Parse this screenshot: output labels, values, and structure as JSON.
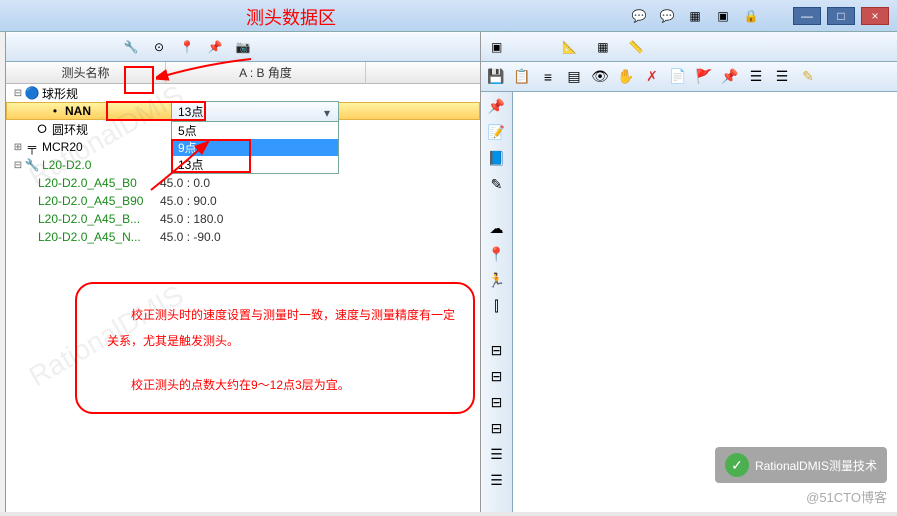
{
  "titlebar_icons": [
    "chat",
    "chat2",
    "grid",
    "layout",
    "lock"
  ],
  "window_controls": {
    "min": "—",
    "max": "□",
    "close": "×"
  },
  "annotation": {
    "title": "测头数据区",
    "note_line1": "校正测头时的速度设置与测量时一致，速度与测量精度有一定关系，尤其是触发测头。",
    "note_line2": "校正测头的点数大约在9～12点3层为宜。"
  },
  "toolbar1_icons": [
    "probe",
    "dot",
    "pin",
    "pin2",
    "camera"
  ],
  "table_headers": {
    "col1": "测头名称",
    "col2": "A : B 角度"
  },
  "tree": {
    "sphere_gauge": "球形规",
    "nan": "NAN",
    "ring_gauge": "圆环规",
    "mcr20": "MCR20",
    "l20": "L20-D2.0",
    "children": [
      {
        "name": "L20-D2.0_A45_B0",
        "angle": "45.0 : 0.0"
      },
      {
        "name": "L20-D2.0_A45_B90",
        "angle": "45.0 : 90.0"
      },
      {
        "name": "L20-D2.0_A45_B...",
        "angle": "45.0 : 180.0"
      },
      {
        "name": "L20-D2.0_A45_N...",
        "angle": "45.0 : -90.0"
      }
    ]
  },
  "dropdown": {
    "current": "13点",
    "options": [
      "5点",
      "9点",
      "13点"
    ]
  },
  "right_toolbar1": [
    "panel",
    "axis",
    "grid2",
    "ruler"
  ],
  "right_toolbar2": [
    "save",
    "props",
    "layer",
    "stack",
    "vis",
    "hand",
    "del",
    "copy",
    "flag",
    "mark",
    "list",
    "list2",
    "pen"
  ],
  "vtoolbar": [
    "pin",
    "note",
    "book",
    "edit",
    "—",
    "cloud",
    "pin2",
    "run",
    "vline",
    "spacer",
    "h1",
    "h2",
    "h3",
    "h4",
    "list1",
    "list2"
  ],
  "watermark": {
    "title": "RationalDMIS测量技术",
    "sub": "@51CTO博客",
    "faint": "RationalDMIS"
  }
}
